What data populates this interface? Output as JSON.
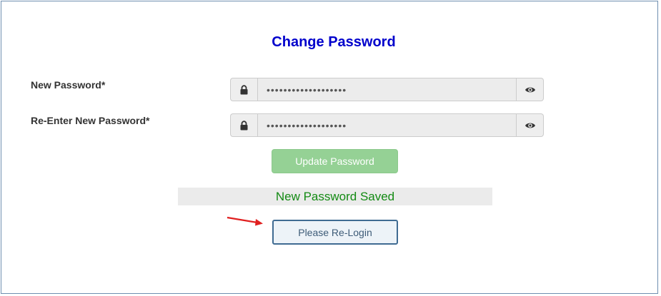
{
  "form": {
    "title": "Change Password",
    "new_password": {
      "label": "New Password*",
      "value": "•••••••••••••••••••"
    },
    "reenter_password": {
      "label": "Re-Enter New Password*",
      "value": "•••••••••••••••••••"
    },
    "update_button_label": "Update Password",
    "status_message": "New Password Saved",
    "relogin_button_label": "Please Re-Login"
  },
  "icons": {
    "lock": "lock-icon",
    "eye": "eye-icon",
    "annotation_arrow": "arrow-icon"
  },
  "colors": {
    "title": "#0000cc",
    "update_button": "#95d195",
    "status_text": "#138a13",
    "relogin_border": "#3f6b92",
    "annotation_arrow": "#e02020"
  }
}
